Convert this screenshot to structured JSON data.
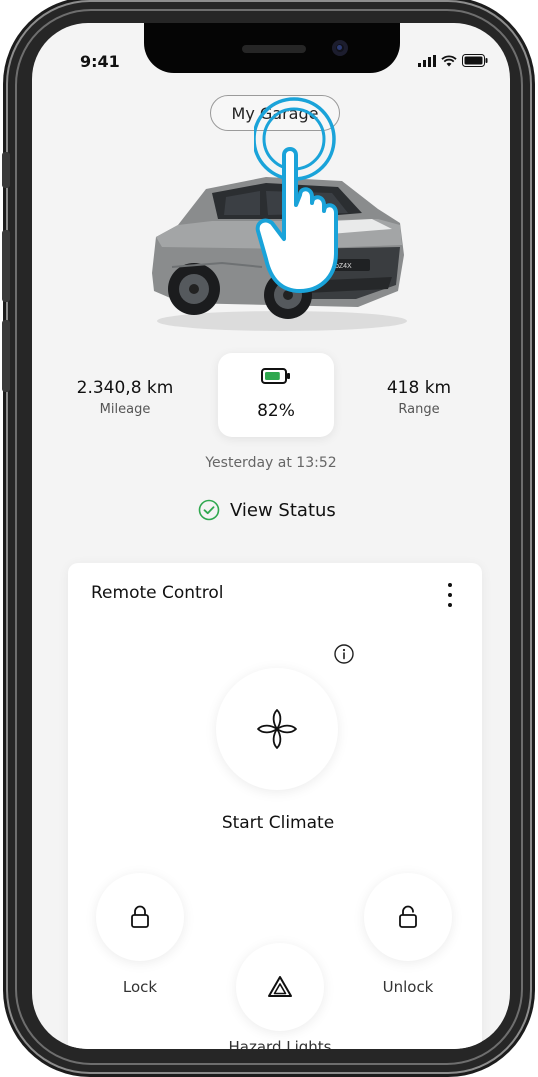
{
  "status_bar": {
    "time": "9:41"
  },
  "header": {
    "garage_label": "My Garage"
  },
  "vehicle": {
    "plate": "bZ4X",
    "mileage_value": "2.340,8 km",
    "mileage_label": "Mileage",
    "battery_percent": "82%",
    "battery_level": 0.82,
    "range_value": "418 km",
    "range_label": "Range",
    "updated": "Yesterday at 13:52",
    "view_status_label": "View Status"
  },
  "remote_control": {
    "title": "Remote Control",
    "climate_label": "Start Climate",
    "lock_label": "Lock",
    "unlock_label": "Unlock",
    "hazard_label": "Hazard Lights"
  },
  "icons": {
    "battery": "battery-icon",
    "status": "check-circle-icon",
    "info": "info-icon",
    "climate": "fan-icon",
    "lock": "lock-icon",
    "unlock": "unlock-icon",
    "hazard": "hazard-icon",
    "menu": "more-vertical-icon",
    "tap_hint": "hand-tap-icon"
  },
  "colors": {
    "accent_green": "#2fa84f",
    "tap_hint_blue": "#1aa3d9",
    "screen_bg": "#f4f4f4"
  }
}
